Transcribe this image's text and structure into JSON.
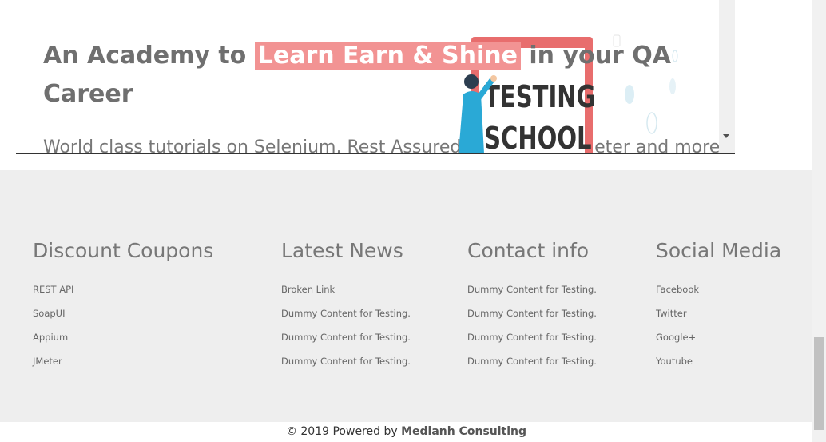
{
  "hero": {
    "title_before": "An Academy to ",
    "title_highlight": "Learn Earn & Shine",
    "title_after": "  in your QA Career",
    "subtitle": "World class tutorials on Selenium, Rest Assured, Cucumber, JMeter and more",
    "illustration_text_1": "TESTING",
    "illustration_text_2": "SCHOOL"
  },
  "footer": {
    "discount": {
      "heading": "Discount Coupons",
      "items": [
        "REST API",
        "SoapUI",
        "Appium",
        "JMeter"
      ]
    },
    "news": {
      "heading": "Latest News",
      "items": [
        "Broken Link",
        "Dummy Content for Testing.",
        "Dummy Content for Testing.",
        "Dummy Content for Testing."
      ]
    },
    "contact": {
      "heading": "Contact info",
      "items": [
        "Dummy Content for Testing.",
        "Dummy Content for Testing.",
        "Dummy Content for Testing.",
        "Dummy Content for Testing."
      ]
    },
    "social": {
      "heading": "Social Media",
      "items": [
        "Facebook",
        "Twitter",
        "Google+",
        "Youtube"
      ]
    }
  },
  "copyright": {
    "prefix": "© 2019 Powered by ",
    "brand": "Medianh Consulting"
  },
  "colors": {
    "highlight": "#f29393",
    "footer_bg": "#eeeeee",
    "heading": "#777777"
  }
}
